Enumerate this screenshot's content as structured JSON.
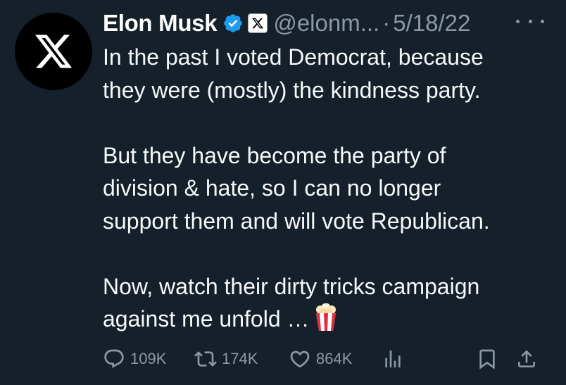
{
  "author": {
    "name": "Elon Musk",
    "handle": "@elonm...",
    "separator": "·",
    "date": "5/18/22",
    "avatar_icon": "x-logo-icon",
    "verified_icon": "verified-badge-icon",
    "affiliation_icon": "x-affiliation-icon"
  },
  "tweet": {
    "lines": [
      "In the past I voted Democrat, because",
      "they were (mostly) the kindness party.",
      "",
      "But they have become the party of",
      "division & hate, so I can no longer",
      "support them and will vote Republican.",
      "",
      "Now, watch their dirty tricks campaign",
      "against me unfold …"
    ],
    "emoji": "popcorn"
  },
  "actions": {
    "replies": "109K",
    "retweets": "174K",
    "likes": "864K"
  },
  "colors": {
    "background": "#15202b",
    "text": "#e7e9ea",
    "secondary": "#8b98a5",
    "verified": "#1d9bf0"
  }
}
